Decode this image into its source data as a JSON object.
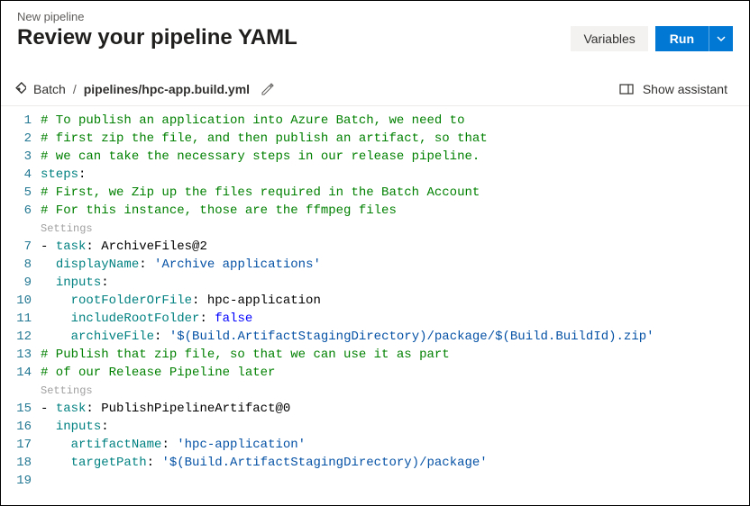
{
  "header": {
    "crumb": "New pipeline",
    "title": "Review your pipeline YAML",
    "variables_label": "Variables",
    "run_label": "Run"
  },
  "subhead": {
    "repo": "Batch",
    "path": "pipelines/hpc-app.build.yml",
    "assistant_label": "Show assistant"
  },
  "lines": [
    {
      "n": "1",
      "type": "comment",
      "text": "# To publish an application into Azure Batch, we need to"
    },
    {
      "n": "2",
      "type": "comment",
      "text": "# first zip the file, and then publish an artifact, so that"
    },
    {
      "n": "3",
      "type": "comment",
      "text": "# we can take the necessary steps in our release pipeline."
    },
    {
      "n": "4",
      "type": "kv",
      "key": "steps",
      "after": ":"
    },
    {
      "n": "5",
      "type": "comment",
      "text": "# First, we Zip up the files required in the Batch Account"
    },
    {
      "n": "6",
      "type": "comment",
      "text": "# For this instance, those are the ffmpeg files"
    },
    {
      "n": "",
      "type": "hint",
      "text": "Settings"
    },
    {
      "n": "7",
      "type": "kv",
      "prefix": "- ",
      "key": "task",
      "after": ": ",
      "valClass": "p",
      "val": "ArchiveFiles@2"
    },
    {
      "n": "8",
      "type": "kv",
      "indent": "  ",
      "key": "displayName",
      "after": ": ",
      "valClass": "s",
      "val": "'Archive applications'"
    },
    {
      "n": "9",
      "type": "kv",
      "indent": "  ",
      "key": "inputs",
      "after": ":"
    },
    {
      "n": "10",
      "type": "kv",
      "indent": "    ",
      "key": "rootFolderOrFile",
      "after": ": ",
      "valClass": "p",
      "val": "hpc-application"
    },
    {
      "n": "11",
      "type": "kv",
      "indent": "    ",
      "key": "includeRootFolder",
      "after": ": ",
      "valClass": "kw",
      "val": "false"
    },
    {
      "n": "12",
      "type": "kv",
      "indent": "    ",
      "key": "archiveFile",
      "after": ": ",
      "valClass": "s",
      "val": "'$(Build.ArtifactStagingDirectory)/package/$(Build.BuildId).zip'"
    },
    {
      "n": "13",
      "type": "comment",
      "text": "# Publish that zip file, so that we can use it as part"
    },
    {
      "n": "14",
      "type": "comment",
      "text": "# of our Release Pipeline later"
    },
    {
      "n": "",
      "type": "hint",
      "text": "Settings"
    },
    {
      "n": "15",
      "type": "kv",
      "prefix": "- ",
      "key": "task",
      "after": ": ",
      "valClass": "p",
      "val": "PublishPipelineArtifact@0"
    },
    {
      "n": "16",
      "type": "kv",
      "indent": "  ",
      "key": "inputs",
      "after": ":"
    },
    {
      "n": "17",
      "type": "kv",
      "indent": "    ",
      "key": "artifactName",
      "after": ": ",
      "valClass": "s",
      "val": "'hpc-application'"
    },
    {
      "n": "18",
      "type": "kv",
      "indent": "    ",
      "key": "targetPath",
      "after": ": ",
      "valClass": "s",
      "val": "'$(Build.ArtifactStagingDirectory)/package'"
    },
    {
      "n": "19",
      "type": "blank"
    }
  ]
}
